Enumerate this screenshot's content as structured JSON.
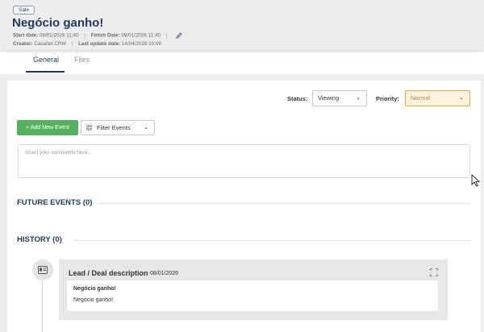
{
  "header": {
    "badge": "Sale",
    "title": "Negócio ganho!",
    "start_label": "Start date:",
    "start_value": "08/01/2026 11:40",
    "finish_label": "Finish Date:",
    "finish_value": "08/01/2026 11:40",
    "creator_label": "Creator:",
    "creator_value": "Casafari CRM",
    "updated_label": "Last update date:",
    "updated_value": "14/04/2026 15:09",
    "separator": "|"
  },
  "tabs": [
    {
      "label": "General",
      "active": true
    },
    {
      "label": "Files",
      "active": false
    }
  ],
  "filters": {
    "status_label": "Status:",
    "status_value": "Viewing",
    "priority_label": "Priority:",
    "priority_value": "Normal"
  },
  "actions": {
    "add_event": "+ Add New Event",
    "filter_events": "Filter Events"
  },
  "comment": {
    "placeholder": "Insert your comments here..."
  },
  "sections": {
    "future_events": "FUTURE EVENTS (0)",
    "history": "HISTORY (0)"
  },
  "history_items": [
    {
      "title": "Lead / Deal description",
      "date": "08/01/2026",
      "body_bold": "Negócio ganho!",
      "body": "Negócio ganho!"
    }
  ],
  "icons": {
    "edit": "pencil-icon",
    "chevron": "chevron-down-icon",
    "filter": "grid-icon",
    "timeline": "id-card-icon",
    "expand": "expand-icon"
  },
  "colors": {
    "brand": "#1e3a5f",
    "add_button": "#56b15e",
    "priority_border": "#e7a93f",
    "priority_bg": "#fdf2dd"
  }
}
